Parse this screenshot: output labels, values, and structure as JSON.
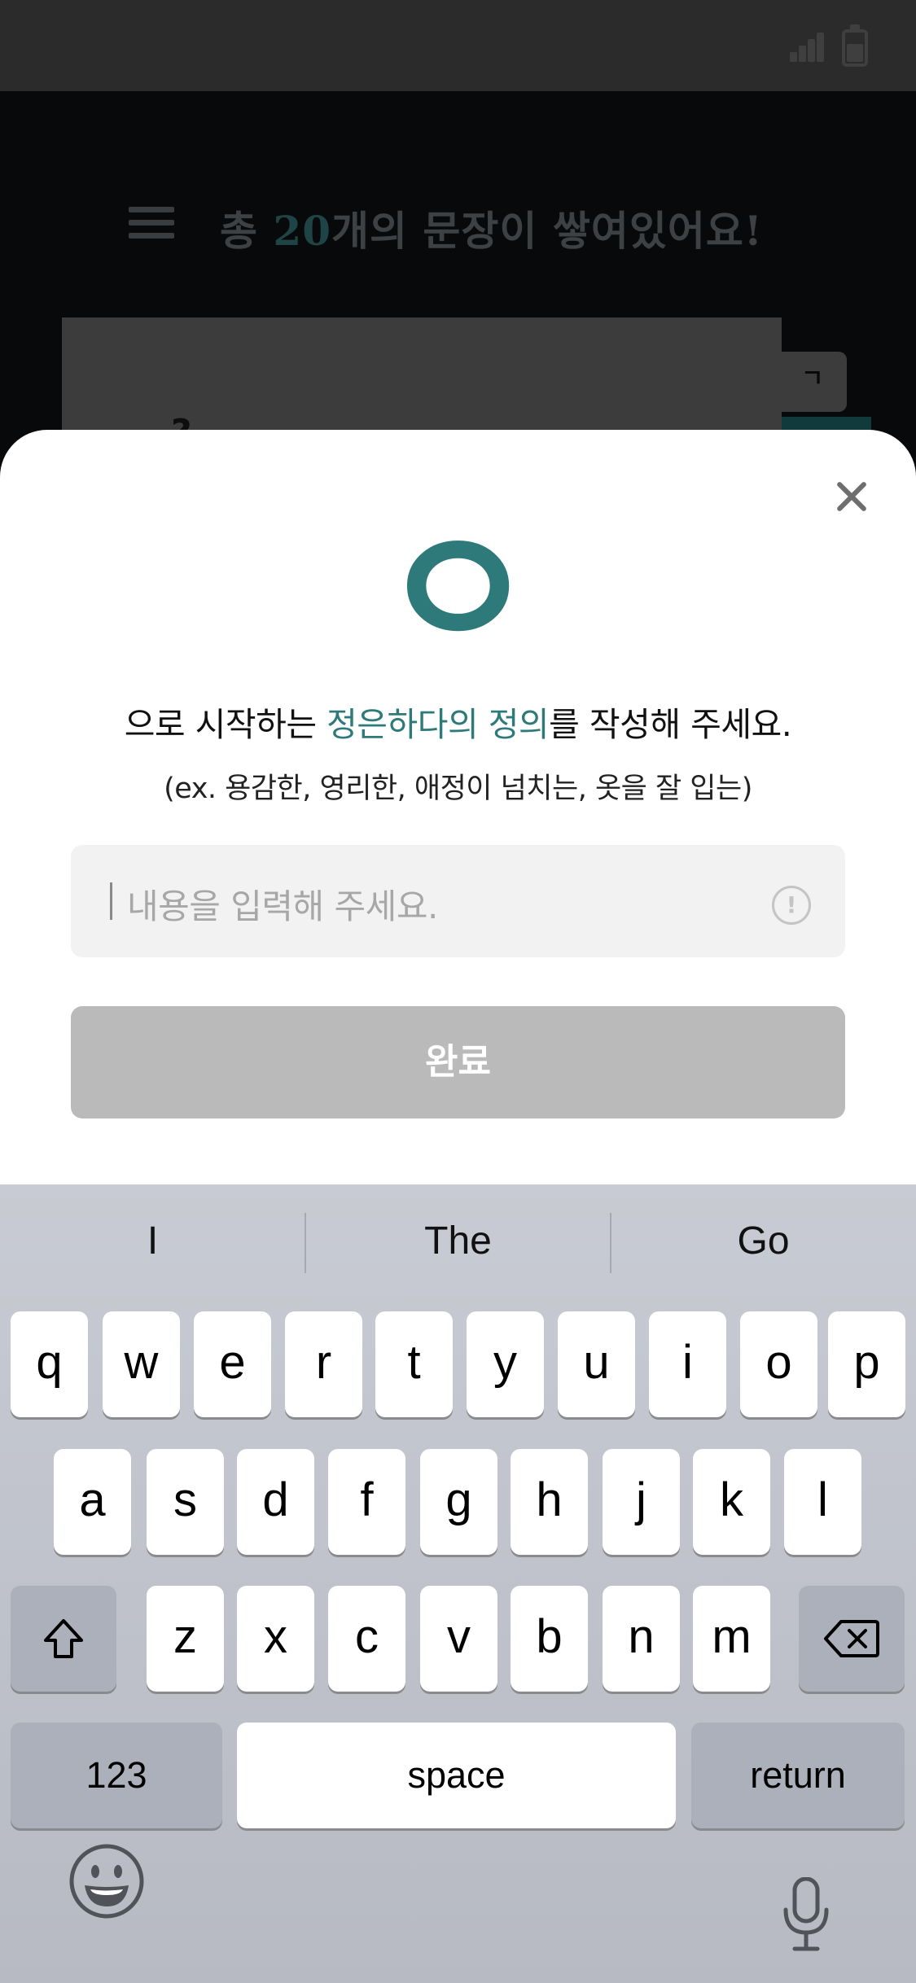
{
  "background": {
    "title_prefix": "총 ",
    "title_count": "20",
    "title_suffix": "개의 문장이 쌓여있어요!",
    "tag": "ㄱ",
    "card_text": "?"
  },
  "sheet": {
    "big_letter": "ㅇ",
    "headline_prefix": "으로 시작하는 ",
    "headline_accent": "정은하다의 정의",
    "headline_suffix": "를 작성해 주세요.",
    "example": "(ex. 용감한, 영리한, 애정이 넘치는, 옷을 잘 입는)",
    "input_placeholder": "내용을 입력해 주세요.",
    "info_icon": "!",
    "done_label": "완료"
  },
  "keyboard": {
    "suggestions": [
      "I",
      "The",
      "Go"
    ],
    "row1": [
      "q",
      "w",
      "e",
      "r",
      "t",
      "y",
      "u",
      "i",
      "o",
      "p"
    ],
    "row2": [
      "a",
      "s",
      "d",
      "f",
      "g",
      "h",
      "j",
      "k",
      "l"
    ],
    "row3": [
      "z",
      "x",
      "c",
      "v",
      "b",
      "n",
      "m"
    ],
    "numbers_label": "123",
    "space_label": "space",
    "return_label": "return"
  },
  "colors": {
    "accent": "#2e7a7a",
    "done_button": "#bababa",
    "input_bg": "#f2f2f2"
  },
  "icons": [
    "signal-icon",
    "battery-icon",
    "menu-icon",
    "close-icon",
    "info-icon",
    "shift-icon",
    "delete-icon",
    "emoji-icon",
    "mic-icon"
  ]
}
